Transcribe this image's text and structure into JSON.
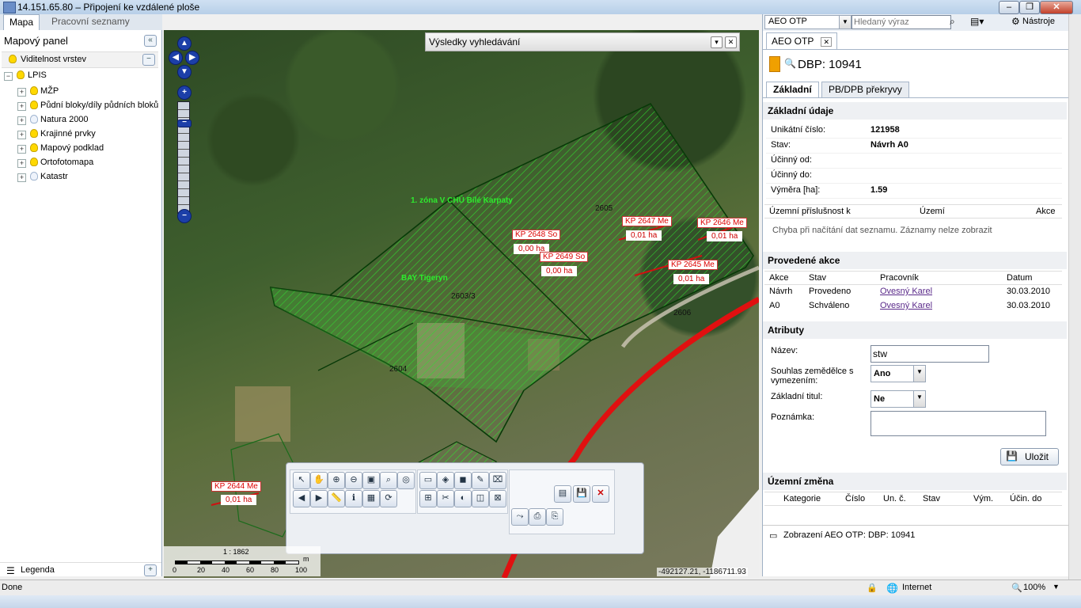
{
  "window": {
    "title": "14.151.65.80 – Připojení ke vzdálené ploše"
  },
  "left": {
    "tabs": [
      "Mapa",
      "Pracovní seznamy"
    ],
    "panel_title": "Mapový panel",
    "visibility_title": "Viditelnost vrstev",
    "root_layer": "LPIS",
    "layers": [
      "MŽP",
      "Půdní bloky/díly půdních bloků",
      "Natura 2000",
      "Krajinné prvky",
      "Mapový podklad",
      "Ortofotomapa",
      "Katastr"
    ],
    "layers_on": [
      true,
      true,
      false,
      true,
      true,
      true,
      false
    ],
    "legend": "Legenda"
  },
  "map": {
    "search_results_title": "Výsledky vyhledávání",
    "zone_label": "1. zóna V CHÚ Bílé Karpaty",
    "zone_label2": "BAY Tigeryn",
    "parcels": [
      "2605",
      "2603/3",
      "2604",
      "2606"
    ],
    "kp_labels": [
      {
        "label": "KP 2648 So",
        "value": "0,00 ha"
      },
      {
        "label": "KP 2649 So",
        "value": "0,00 ha"
      },
      {
        "label": "KP 2647 Me",
        "value": "0,01 ha"
      },
      {
        "label": "KP 2646 Me",
        "value": "0,01 ha"
      },
      {
        "label": "KP 2645 Me",
        "value": "0,01 ha"
      },
      {
        "label": "KP 2644 Me",
        "value": "0,01 ha"
      }
    ],
    "scale": "1 : 1862",
    "scale_unit": "m",
    "scale_ticks": [
      "0",
      "20",
      "40",
      "60",
      "80",
      "100"
    ],
    "coords": "-492127.21, -1186711.93"
  },
  "right": {
    "search_select": "AEO OTP",
    "search_placeholder": "Hledaný výraz",
    "tools": "Nástroje",
    "tab": "AEO OTP",
    "record_title": "DBP: 10941",
    "subtabs": [
      "Základní",
      "PB/DPB překryvy"
    ],
    "basic_title": "Základní údaje",
    "basic": [
      {
        "k": "Unikátní číslo:",
        "v": "121958"
      },
      {
        "k": "Stav:",
        "v": "Návrh A0"
      },
      {
        "k": "Účinný od:",
        "v": ""
      },
      {
        "k": "Účinný do:",
        "v": ""
      },
      {
        "k": "Výměra [ha]:",
        "v": "1.59"
      }
    ],
    "territory_cols": [
      "Územní příslušnost k",
      "Území",
      "Akce"
    ],
    "territory_error": "Chyba při načítání dat seznamu. Záznamy nelze zobrazit",
    "actions_title": "Provedené akce",
    "actions_cols": [
      "Akce",
      "Stav",
      "Pracovník",
      "Datum"
    ],
    "actions_rows": [
      {
        "akce": "Návrh",
        "stav": "Provedeno",
        "pracovnik": "Ovesný Karel",
        "datum": "30.03.2010"
      },
      {
        "akce": "A0",
        "stav": "Schváleno",
        "pracovnik": "Ovesný Karel",
        "datum": "30.03.2010"
      }
    ],
    "attributes_title": "Atributy",
    "attr_name_label": "Název:",
    "attr_name_value": "stw",
    "attr_consent_label": "Souhlas zemědělce s vymezením:",
    "attr_consent_value": "Ano",
    "attr_title_label": "Základní titul:",
    "attr_title_value": "Ne",
    "attr_note_label": "Poznámka:",
    "save": "Uložit",
    "change_title": "Územní změna",
    "change_cols": [
      "Kategorie",
      "Číslo",
      "Un. č.",
      "Stav",
      "Vým.",
      "Účin. do"
    ],
    "bottom_info": "Zobrazení AEO OTP: DBP: 10941"
  },
  "status": {
    "left": "Done",
    "zone": "Internet",
    "zoom": "100%"
  },
  "colors": {
    "accent": "#f0a000",
    "link": "#5a2a8a",
    "zone": "#22c322"
  }
}
